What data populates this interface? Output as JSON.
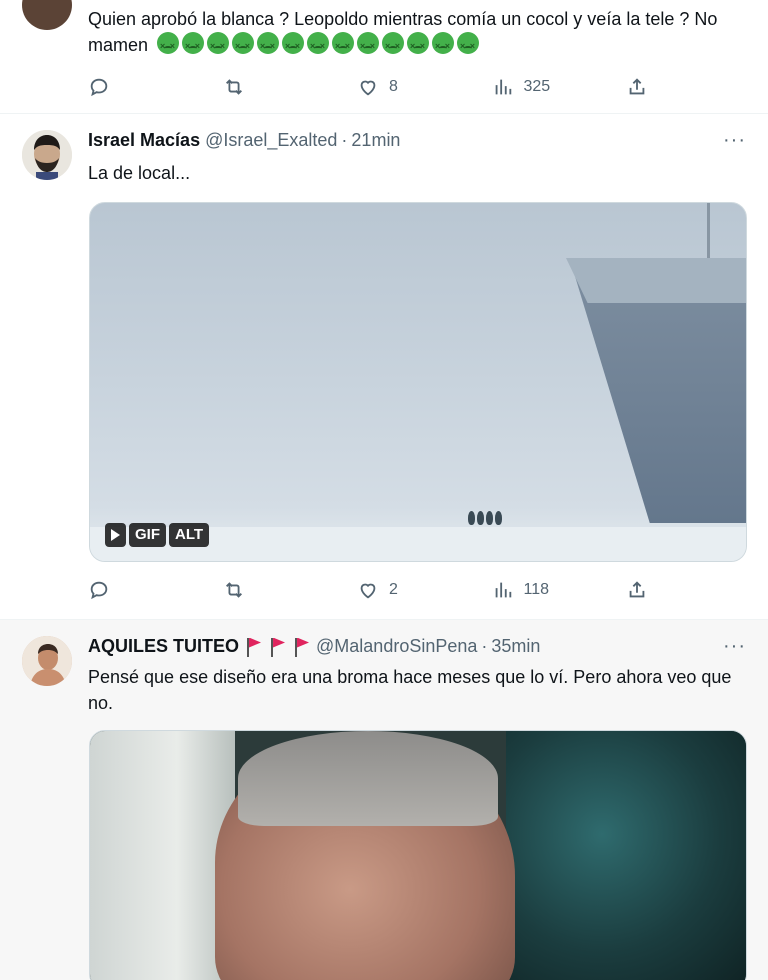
{
  "tweets": [
    {
      "text": "Quien aprobó la blanca ? Leopoldo mientras comía un cocol y veía la tele ? No mamen",
      "emoji_count": 13,
      "emoji_icon": "nauseated-face-icon",
      "actions": {
        "reply": "",
        "retweet": "",
        "likes": "8",
        "views": "325",
        "share": ""
      }
    },
    {
      "name": "Israel Macías",
      "handle": "@Israel_Exalted",
      "time": "21min",
      "text": "La de local...",
      "media": {
        "type": "gif",
        "badges": [
          "GIF",
          "ALT"
        ]
      },
      "actions": {
        "reply": "",
        "retweet": "",
        "likes": "2",
        "views": "118",
        "share": ""
      }
    },
    {
      "name": "AQUILES TUITEO",
      "flags": 3,
      "handle": "@MalandroSinPena",
      "time": "35min",
      "text": "Pensé que ese diseño era una broma hace meses que lo ví. Pero ahora veo que no."
    }
  ],
  "separator": "·",
  "more_label": "···"
}
